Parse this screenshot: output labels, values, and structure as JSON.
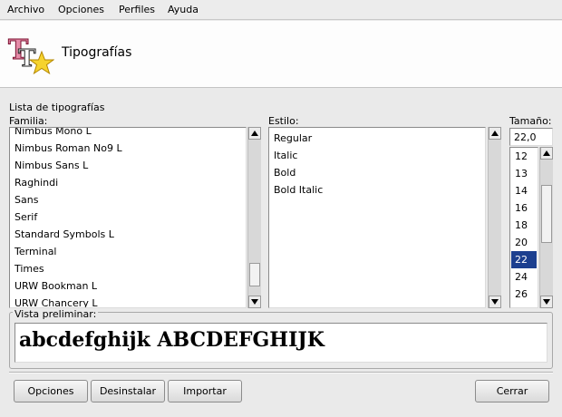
{
  "menubar": [
    {
      "label": "Archivo"
    },
    {
      "label": "Opciones"
    },
    {
      "label": "Perfiles"
    },
    {
      "label": "Ayuda"
    }
  ],
  "header": {
    "title": "Tipografías",
    "icon": "fonts-app-icon"
  },
  "section_label": "Lista de tipografías",
  "family": {
    "label": "Familia:",
    "items": [
      "Nimbus Mono L",
      "Nimbus Roman No9 L",
      "Nimbus Sans L",
      "Raghindi",
      "Sans",
      "Serif",
      "Standard Symbols L",
      "Terminal",
      "Times",
      "URW Bookman L",
      "URW Chancery L"
    ]
  },
  "style": {
    "label": "Estilo:",
    "items": [
      "Regular",
      "Italic",
      "Bold",
      "Bold Italic"
    ]
  },
  "size": {
    "label": "Tamaño:",
    "value": "22,0",
    "items": [
      "12",
      "13",
      "14",
      "16",
      "18",
      "20",
      "22",
      "24",
      "26"
    ],
    "selected": "22"
  },
  "preview": {
    "label": "Vista preliminar:",
    "text": "abcdefghijk ABCDEFGHIJK"
  },
  "buttons": {
    "options": "Opciones",
    "uninstall": "Desinstalar",
    "import": "Importar",
    "close": "Cerrar"
  },
  "colors": {
    "selection": "#1c3f8f",
    "header_bg": "#fdfdfd",
    "window_bg": "#eaeaea"
  }
}
